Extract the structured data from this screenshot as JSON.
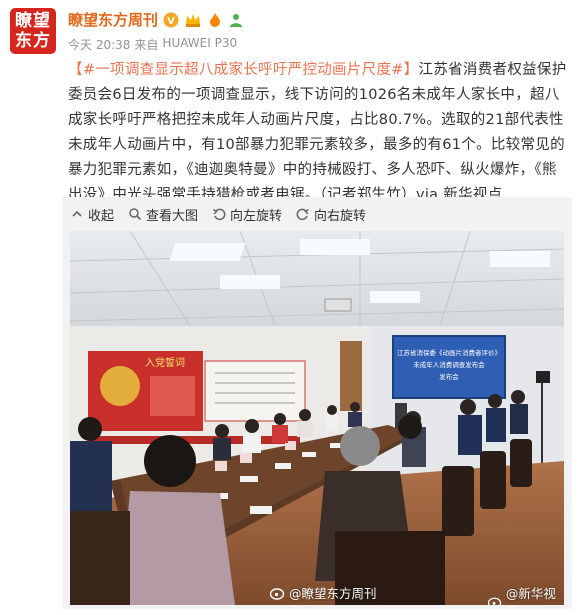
{
  "author": {
    "avatar_line1": "瞭望",
    "avatar_line2": "东方",
    "name": "瞭望东方周刊"
  },
  "meta": {
    "time": "今天 20:38",
    "source_prefix": "来自",
    "device": "HUAWEI P30"
  },
  "post": {
    "hashtag": "#一项调查显示超八成家长呼吁严控动画片尺度#",
    "body": "江苏省消费者权益保护委员会6日发布的一项调查显示，线下访问的1026名未成年人家长中，超八成家长呼吁严格把控未成年人动画片尺度，占比80.7%。选取的21部代表性未成年人动画片中，有10部暴力犯罪元素较多，最多的有61个。比较常见的暴力犯罪元素如，《迪迦奥特曼》中的持械殴打、多人恐吓、纵火爆炸，《熊出没》中光头强常手持猎枪或者电锯。（记者郑生竹）via.新华视点"
  },
  "toolbar": {
    "collapse": "收起",
    "view_large": "查看大图",
    "rotate_left": "向左旋转",
    "rotate_right": "向右旋转"
  },
  "photo": {
    "screen_line1": "江苏省消保委《动画片消费者评价》",
    "screen_line2": "未成年人消费调查发布会",
    "screen_line3": "发布会",
    "wall_sign": "入党誓词",
    "watermark_left": "@瞭望东方周刊",
    "watermark_right": "@新华视点"
  },
  "colors": {
    "hashtag": "#eb7350",
    "author_name": "#e06a1d",
    "avatar_bg": "#d4261d"
  }
}
